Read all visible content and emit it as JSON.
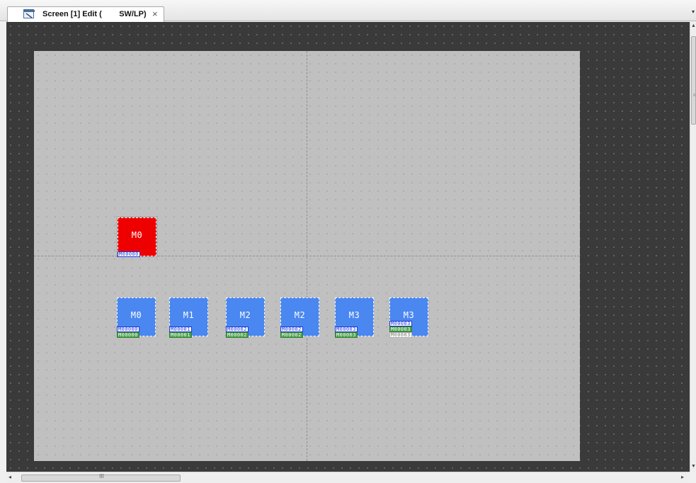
{
  "tab": {
    "title": "Screen [1] Edit (        SW/LP)",
    "close": "×",
    "icon": "screen-edit-icon"
  },
  "scroll": {
    "up": "▲",
    "down": "▼",
    "left": "◂",
    "right": "▸",
    "vgrip": "≡",
    "hgrip": "III",
    "menu": "▾"
  },
  "screen_background": "#c0c0c0",
  "workspace_background": "#3a3a3a",
  "lamp": {
    "label": "M0",
    "device": "M00000",
    "color": "#ee0000"
  },
  "buttons": [
    {
      "label": "M0",
      "devices": [
        "M00000",
        "M00000"
      ],
      "color": "#4a87f0"
    },
    {
      "label": "M1",
      "devices": [
        "M00001",
        "M00001"
      ],
      "color": "#4a87f0"
    },
    {
      "label": "M2",
      "devices": [
        "M00002",
        "M00002"
      ],
      "color": "#4a87f0"
    },
    {
      "label": "M2",
      "devices": [
        "M00002",
        "M00002"
      ],
      "color": "#4a87f0"
    },
    {
      "label": "M3",
      "devices": [
        "M00003",
        "M00003"
      ],
      "color": "#4a87f0"
    },
    {
      "label": "M3",
      "devices": [
        "M00003",
        "M00003",
        "M00003"
      ],
      "color": "#4a87f0"
    }
  ]
}
